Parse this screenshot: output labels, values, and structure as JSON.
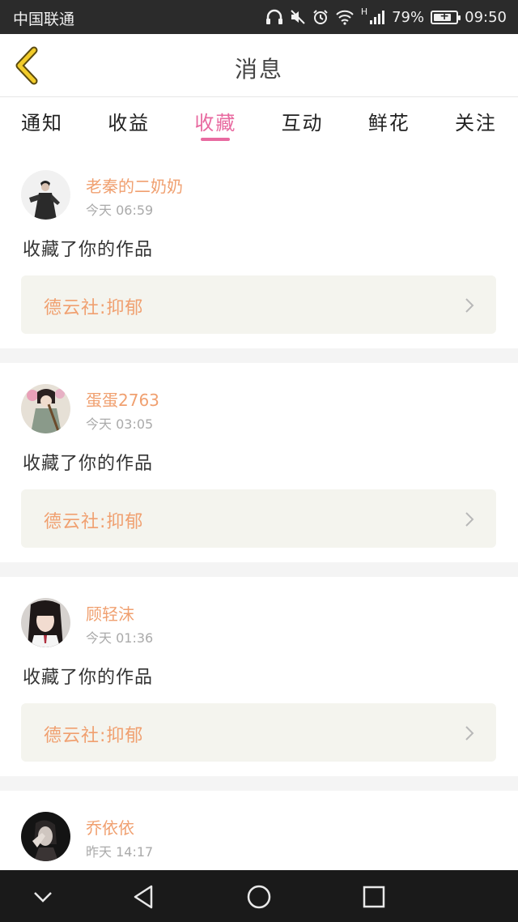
{
  "status_bar": {
    "carrier": "中国联通",
    "network": "H",
    "battery_percent": "79%",
    "battery_level": 0.79,
    "time": "09:50"
  },
  "header": {
    "title": "消息",
    "back_icon": "chevron-left-icon",
    "accent_color": "#f0c020"
  },
  "tabs": [
    {
      "label": "通知",
      "active": false
    },
    {
      "label": "收益",
      "active": false
    },
    {
      "label": "收藏",
      "active": true
    },
    {
      "label": "互动",
      "active": false
    },
    {
      "label": "鲜花",
      "active": false
    },
    {
      "label": "关注",
      "active": false
    }
  ],
  "tab_active_color": "#e86aa0",
  "name_color": "#f0a070",
  "messages": [
    {
      "name": "老秦的二奶奶",
      "time": "今天 06:59",
      "action": "收藏了你的作品",
      "work": "德云社:抑郁"
    },
    {
      "name": "蛋蛋2763",
      "time": "今天 03:05",
      "action": "收藏了你的作品",
      "work": "德云社:抑郁"
    },
    {
      "name": "顾轻沫",
      "time": "今天 01:36",
      "action": "收藏了你的作品",
      "work": "德云社:抑郁"
    },
    {
      "name": "乔依依",
      "time": "昨天 14:17"
    }
  ],
  "nav_bar": {
    "icons": [
      "chevron-down-icon",
      "back-triangle-icon",
      "home-circle-icon",
      "recent-square-icon"
    ]
  }
}
